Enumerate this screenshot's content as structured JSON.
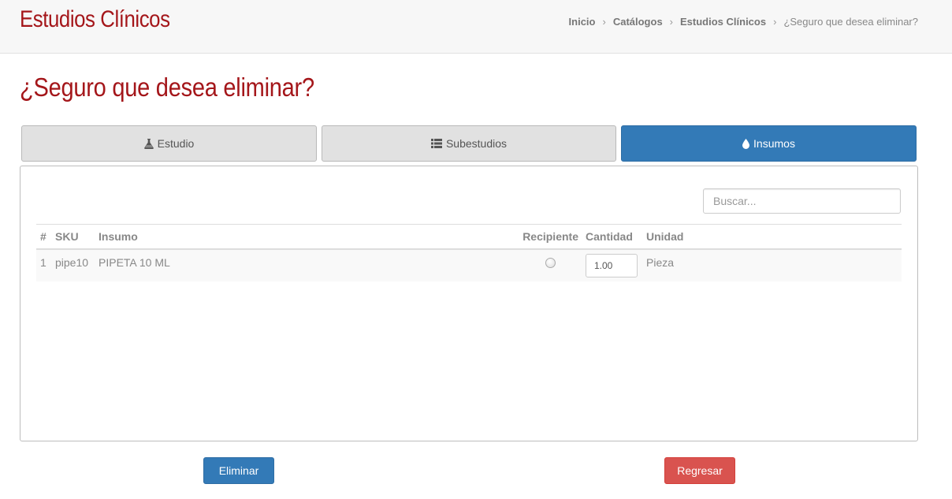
{
  "header": {
    "app_title": "Estudios Clínicos",
    "breadcrumb": [
      {
        "label": "Inicio"
      },
      {
        "label": "Catálogos"
      },
      {
        "label": "Estudios Clínicos"
      },
      {
        "label": "¿Seguro que desea eliminar?"
      }
    ],
    "separator": "›"
  },
  "page": {
    "title": "¿Seguro que desea eliminar?"
  },
  "tabs": [
    {
      "label": "Estudio",
      "icon": "flask-icon",
      "active": false
    },
    {
      "label": "Subestudios",
      "icon": "list-icon",
      "active": false
    },
    {
      "label": "Insumos",
      "icon": "tint-icon",
      "active": true
    }
  ],
  "search": {
    "placeholder": "Buscar..."
  },
  "table": {
    "headers": [
      "#",
      "SKU",
      "Insumo",
      "Recipiente",
      "Cantidad",
      "Unidad"
    ],
    "rows": [
      {
        "num": "1",
        "sku": "pipe10",
        "insumo": "PIPETA 10 ML",
        "recipiente": false,
        "cantidad": "1.00",
        "unidad": "Pieza"
      }
    ]
  },
  "actions": {
    "delete_label": "Eliminar",
    "back_label": "Regresar"
  },
  "colors": {
    "brand_red": "#a4161a",
    "primary": "#337ab7",
    "danger": "#d9534f"
  }
}
